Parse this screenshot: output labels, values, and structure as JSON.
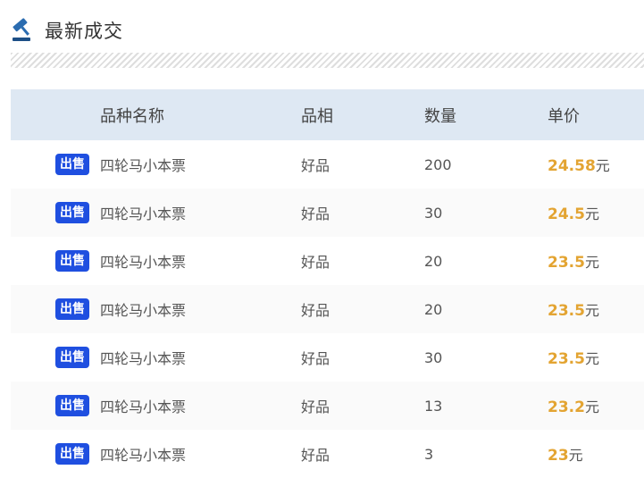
{
  "header": {
    "title": "最新成交",
    "icon": "gavel-icon"
  },
  "table": {
    "columns": [
      "品种名称",
      "品相",
      "数量",
      "单价"
    ],
    "rows": [
      {
        "badge": "出售",
        "name": "四轮马小本票",
        "grade": "好品",
        "qty": "200",
        "price": "24.58",
        "unit": "元"
      },
      {
        "badge": "出售",
        "name": "四轮马小本票",
        "grade": "好品",
        "qty": "30",
        "price": "24.5",
        "unit": "元"
      },
      {
        "badge": "出售",
        "name": "四轮马小本票",
        "grade": "好品",
        "qty": "20",
        "price": "23.5",
        "unit": "元"
      },
      {
        "badge": "出售",
        "name": "四轮马小本票",
        "grade": "好品",
        "qty": "20",
        "price": "23.5",
        "unit": "元"
      },
      {
        "badge": "出售",
        "name": "四轮马小本票",
        "grade": "好品",
        "qty": "30",
        "price": "23.5",
        "unit": "元"
      },
      {
        "badge": "出售",
        "name": "四轮马小本票",
        "grade": "好品",
        "qty": "13",
        "price": "23.2",
        "unit": "元"
      },
      {
        "badge": "出售",
        "name": "四轮马小本票",
        "grade": "好品",
        "qty": "3",
        "price": "23",
        "unit": "元"
      }
    ]
  },
  "colors": {
    "header_bg": "#dee8f3",
    "badge": "#1f4fe0",
    "price": "#e3a432"
  }
}
